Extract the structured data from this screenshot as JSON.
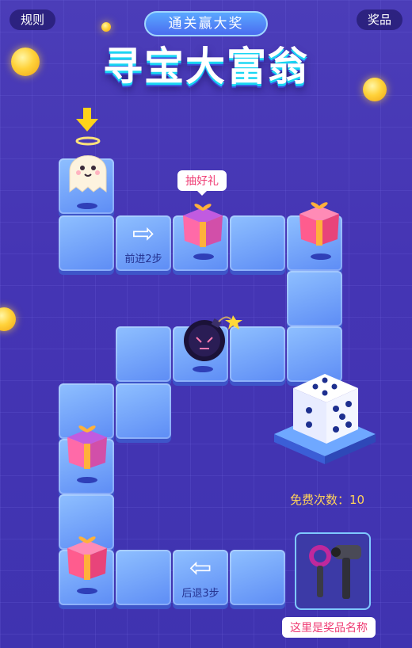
{
  "header": {
    "rules_label": "规则",
    "prizes_label": "奖品",
    "banner_text": "通关赢大奖",
    "title": "寻宝大富翁"
  },
  "board": {
    "bubble_text": "抽好礼",
    "forward_label": "前进2步",
    "back_label": "后退3步",
    "free_label": "免费次数：",
    "free_count": "10",
    "prize_name": "这里是奖品名称"
  },
  "colors": {
    "background": "#4535b4",
    "tile": "#6f9cf7",
    "accent": "#ffd25a",
    "bubble_text": "#ef3b73"
  },
  "icons": [
    "ghost-icon",
    "gift-icon",
    "bomb-icon",
    "dice-icon",
    "arrow-right-icon",
    "arrow-left-icon",
    "hair-dryer-icon",
    "coin-icon"
  ]
}
